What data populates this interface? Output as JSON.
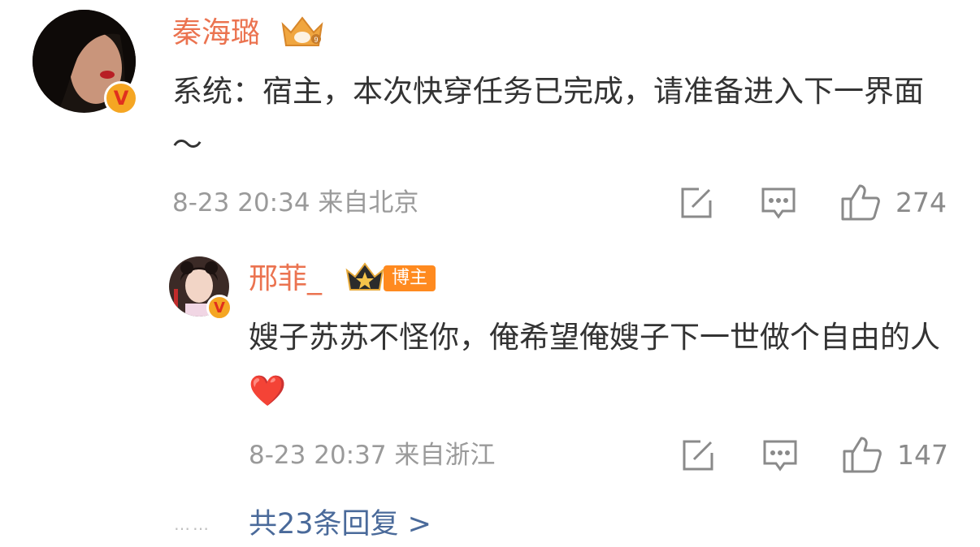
{
  "comment": {
    "username": "秦海璐",
    "text": "系统：宿主，本次快穿任务已完成，请准备进入下一界面～",
    "date": "8-23",
    "time": "20:34",
    "location": "来自北京",
    "likes": "274",
    "icons": [
      "edit-icon",
      "comment-icon",
      "thumbs-up-icon",
      "crown-badge-icon",
      "verified-v-icon"
    ]
  },
  "reply": {
    "username": "邢菲_",
    "host_tag": "博主",
    "text": "嫂子苏苏不怪你，俺希望俺嫂子下一世做个自由的人",
    "emoji": "❤️",
    "date": "8-23",
    "time": "20:37",
    "location": "来自浙江",
    "likes": "147"
  },
  "replies_link": "共23条回复 >",
  "ellipsis": "……",
  "colors": {
    "username": "#eb7350",
    "body_text": "#333333",
    "meta": "#9a9a9a",
    "link": "#4a6a9a",
    "verified_badge": "#f5a623",
    "host_tag": "#ff8a1f"
  }
}
